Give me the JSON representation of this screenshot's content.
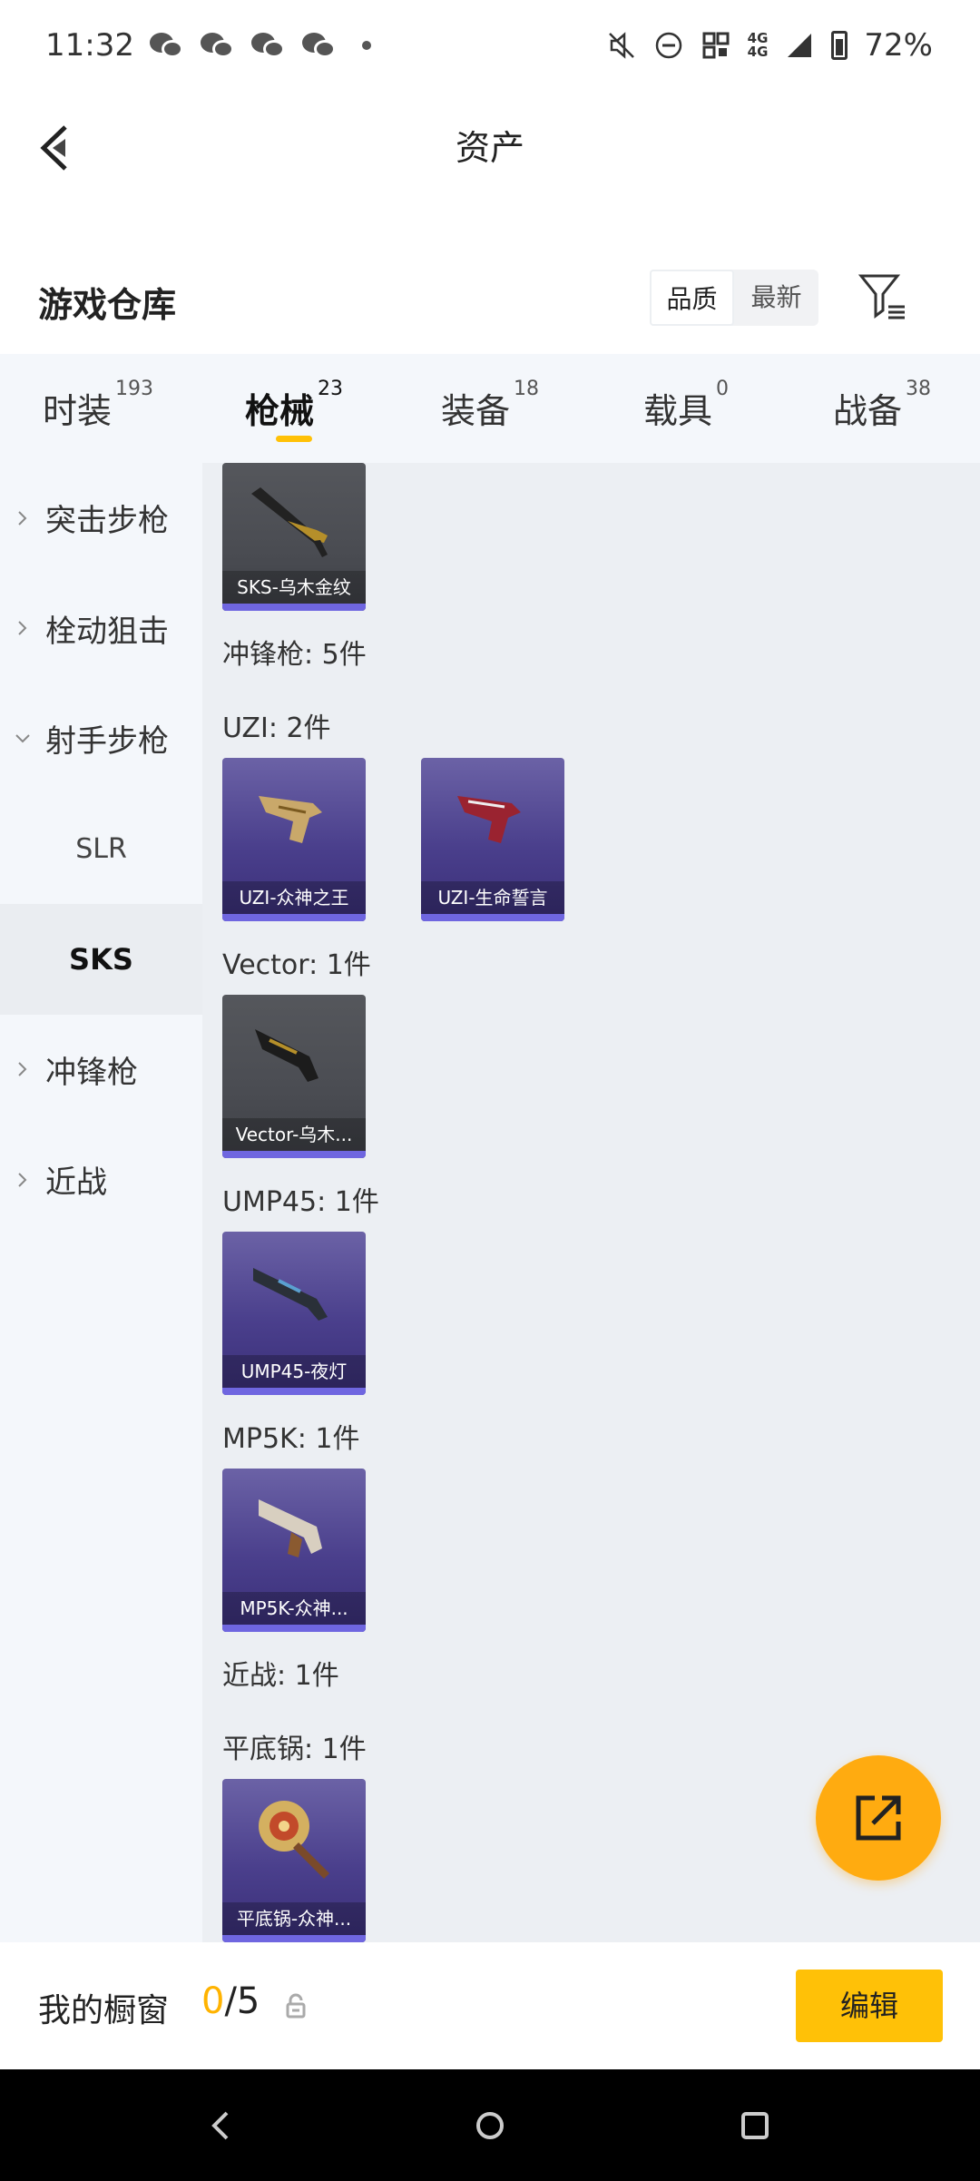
{
  "status": {
    "time": "11:32",
    "network": "4G",
    "battery": "72%"
  },
  "header": {
    "title": "资产"
  },
  "section": {
    "title": "游戏仓库",
    "sort_quality": "品质",
    "sort_latest": "最新"
  },
  "tabs": [
    {
      "label": "时装",
      "count": "193"
    },
    {
      "label": "枪械",
      "count": "23"
    },
    {
      "label": "装备",
      "count": "18"
    },
    {
      "label": "载具",
      "count": "0"
    },
    {
      "label": "战备",
      "count": "38"
    }
  ],
  "sidebar": {
    "items": [
      {
        "label": "突击步枪"
      },
      {
        "label": "栓动狙击"
      },
      {
        "label": "射手步枪"
      },
      {
        "label": "SLR"
      },
      {
        "label": "SKS"
      },
      {
        "label": "冲锋枪"
      },
      {
        "label": "近战"
      }
    ]
  },
  "content": {
    "sks_card": "SKS-乌木金纹",
    "smg_header": "冲锋枪: 5件",
    "uzi_header": "UZI: 2件",
    "uzi_cards": [
      "UZI-众神之王",
      "UZI-生命誓言"
    ],
    "vector_header": "Vector: 1件",
    "vector_card": "Vector-乌木...",
    "ump_header": "UMP45: 1件",
    "ump_card": "UMP45-夜灯",
    "mp5k_header": "MP5K: 1件",
    "mp5k_card": "MP5K-众神...",
    "melee_header": "近战: 1件",
    "pan_header": "平底锅: 1件",
    "pan_card": "平底锅-众神..."
  },
  "showcase": {
    "label": "我的橱窗",
    "current": "0",
    "total": "/5",
    "edit_label": "编辑"
  },
  "colors": {
    "accent": "#ffc107",
    "fab": "#ffab10",
    "rarity_bar": "#6f66e0"
  }
}
